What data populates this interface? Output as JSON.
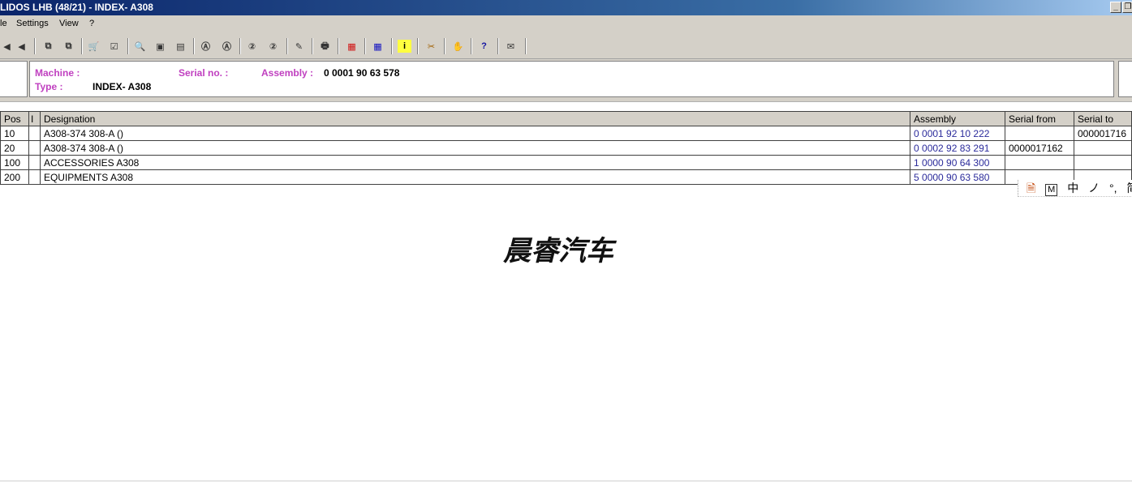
{
  "window": {
    "title": "LIDOS LHB (48/21) - INDEX- A308"
  },
  "menu": [
    "le",
    "Settings",
    "View",
    "?"
  ],
  "toolbar": [
    {
      "icon": "first-record-icon",
      "glyph": "◀"
    },
    {
      "icon": "prev-record-icon",
      "glyph": "◀"
    },
    {
      "icon": "doc-back-icon",
      "glyph": "⧉"
    },
    {
      "icon": "doc-forward-icon",
      "glyph": "⧉"
    },
    {
      "icon": "cart-icon",
      "glyph": "🛒"
    },
    {
      "icon": "checklist-icon",
      "glyph": "☑"
    },
    {
      "icon": "zoom-icon",
      "glyph": "🔍"
    },
    {
      "icon": "fit-page-icon",
      "glyph": "▣"
    },
    {
      "icon": "fit-width-icon",
      "glyph": "▤"
    },
    {
      "icon": "search-a-icon",
      "glyph": "Ⓐ"
    },
    {
      "icon": "search-a-next-icon",
      "glyph": "Ⓐ"
    },
    {
      "icon": "search-2-icon",
      "glyph": "②"
    },
    {
      "icon": "search-2-next-icon",
      "glyph": "②"
    },
    {
      "icon": "edit-icon",
      "glyph": "✎"
    },
    {
      "icon": "print-icon",
      "glyph": "🖶"
    },
    {
      "icon": "grid-red-icon",
      "glyph": "▦"
    },
    {
      "icon": "grid-blue-icon",
      "glyph": "▦"
    },
    {
      "icon": "info-icon",
      "glyph": "i"
    },
    {
      "icon": "tools-icon",
      "glyph": "✂"
    },
    {
      "icon": "handshake-icon",
      "glyph": "✋"
    },
    {
      "icon": "help-icon",
      "glyph": "?"
    },
    {
      "icon": "mail-icon",
      "glyph": "✉"
    }
  ],
  "header": {
    "machine_label": "Machine :",
    "type_label": "Type :",
    "type_value": "INDEX- A308",
    "serial_label": "Serial no. :",
    "assembly_label": "Assembly :",
    "assembly_value": "0 0001 90 63 578"
  },
  "table": {
    "columns": [
      "Pos",
      "I",
      "Designation",
      "Assembly",
      "Serial from",
      "Serial to"
    ],
    "rows": [
      {
        "pos": "10",
        "i": "",
        "designation": "A308-374 308-A ()",
        "assembly": "0 0001 92 10 222",
        "serial_from": "",
        "serial_to": "000001716"
      },
      {
        "pos": "20",
        "i": "",
        "designation": "A308-374 308-A ()",
        "assembly": "0 0002 92 83 291",
        "serial_from": "0000017162",
        "serial_to": ""
      },
      {
        "pos": "100",
        "i": "",
        "designation": "ACCESSORIES A308",
        "assembly": "1 0000 90 64 300",
        "serial_from": "",
        "serial_to": ""
      },
      {
        "pos": "200",
        "i": "",
        "designation": "EQUIPMENTS A308",
        "assembly": "5 0000 90 63 580",
        "serial_from": "",
        "serial_to": ""
      }
    ]
  },
  "ime": [
    "中",
    "ノ",
    "°,",
    "简"
  ],
  "watermark": "晨睿汽车"
}
